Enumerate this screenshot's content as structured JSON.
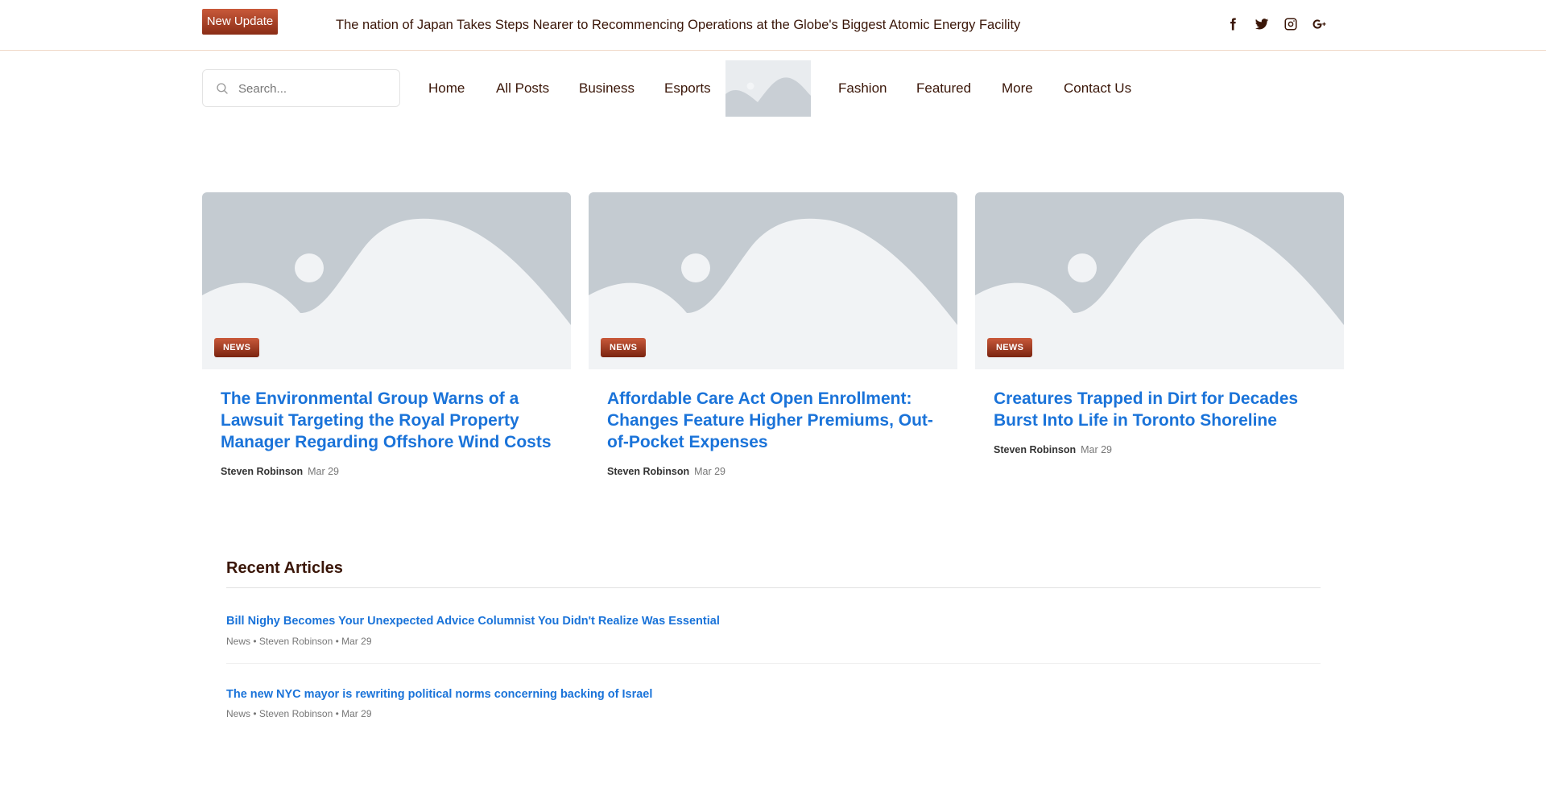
{
  "topbar": {
    "badge": "New Update",
    "ticker": "The nation of Japan Takes Steps Nearer to Recommencing Operations at the Globe's Biggest Atomic Energy Facility",
    "social": [
      "facebook-icon",
      "twitter-icon",
      "instagram-icon",
      "google-plus-icon"
    ]
  },
  "search": {
    "placeholder": "Search..."
  },
  "nav": {
    "items": [
      "Home",
      "All Posts",
      "Business",
      "Esports",
      "Fashion",
      "Featured",
      "More",
      "Contact Us"
    ]
  },
  "cards": [
    {
      "tag": "NEWS",
      "title": "The Environmental Group Warns of a Lawsuit Targeting the Royal Property Manager Regarding Offshore Wind Costs",
      "author": "Steven Robinson",
      "date": "Mar 29"
    },
    {
      "tag": "NEWS",
      "title": "Affordable Care Act Open Enrollment: Changes Feature Higher Premiums, Out-of-Pocket Expenses",
      "author": "Steven Robinson",
      "date": "Mar 29"
    },
    {
      "tag": "NEWS",
      "title": "Creatures Trapped in Dirt for Decades Burst Into Life in Toronto Shoreline",
      "author": "Steven Robinson",
      "date": "Mar 29"
    }
  ],
  "recent": {
    "heading": "Recent Articles",
    "items": [
      {
        "title": "Bill Nighy Becomes Your Unexpected Advice Columnist You Didn't Realize Was Essential",
        "meta": "News • Steven Robinson • Mar 29"
      },
      {
        "title": "The new NYC mayor is rewriting political norms concerning backing of Israel",
        "meta": "News • Steven Robinson • Mar 29"
      }
    ]
  },
  "colors": {
    "accent_gradient_top": "#c9593a",
    "accent_gradient_bottom": "#8a2d16",
    "link": "#1a73d9",
    "text": "#3a1608"
  }
}
